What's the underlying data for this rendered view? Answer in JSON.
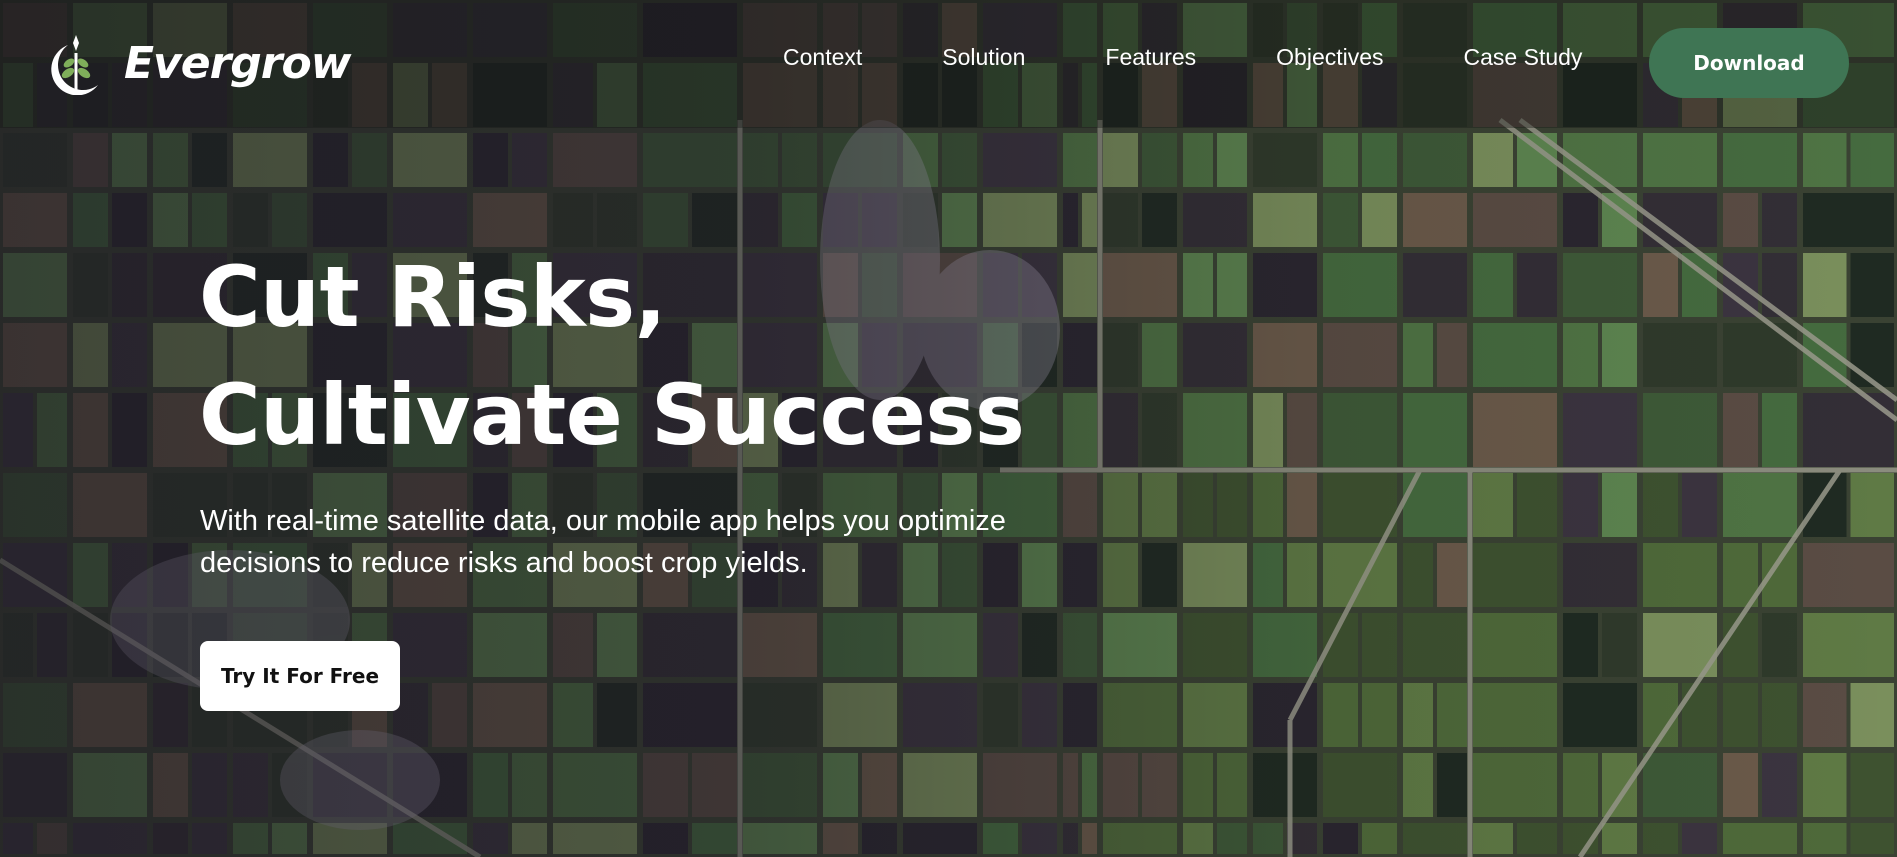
{
  "brand": {
    "name": "Evergrow",
    "logo_icon": "seedling-moon-icon"
  },
  "nav": {
    "links": [
      "Context",
      "Solution",
      "Features",
      "Objectives",
      "Case Study"
    ],
    "download_label": "Download"
  },
  "hero": {
    "title_line1": "Cut Risks,",
    "title_line2": "Cultivate Success",
    "subtitle": "With real-time satellite data, our mobile app helps you optimize decisions to reduce risks and boost crop yields.",
    "cta_label": "Try It For Free",
    "background": "satellite-farmland-image"
  },
  "colors": {
    "accent": "#3f7554",
    "cta_bg": "#ffffff",
    "text": "#ffffff"
  }
}
